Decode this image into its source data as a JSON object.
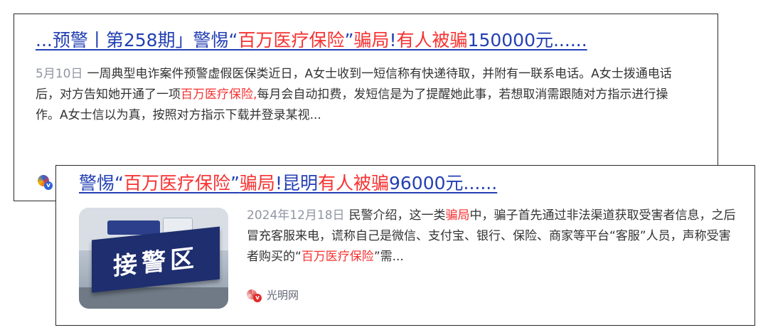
{
  "result1": {
    "title": {
      "seg1": "...预警丨第258期」警惕“",
      "seg2": "百万医疗保险",
      "seg3": "”",
      "seg4": "骗局",
      "seg5": "!",
      "seg6": "有人被骗",
      "seg7": "150000元......"
    },
    "date": "5月10日",
    "snippet": {
      "part1": "一周典型电诈案件预警虚假医保类近日，A女士收到一短信称有快递待取，并附有一联系电话。A女士拨通电话后，对方告知她开通了一项",
      "highlight": "百万医疗保险,",
      "part2": "每月会自动扣费，发短信是为了提醒她此事，若想取消需跟随对方指示进行操作。A女士信以为真，按照对方指示下载并登录某视..."
    },
    "icon": "media-source-icon"
  },
  "result2": {
    "title": {
      "seg1": "警惕“",
      "seg2": "百万医疗保险",
      "seg3": "”",
      "seg4": "骗局",
      "seg5": "!昆明",
      "seg6": "有人被骗",
      "seg7": "96000元......"
    },
    "thumbnail": {
      "sign_text": "接警区"
    },
    "date": "2024年12月18日",
    "snippet": {
      "part1": "民警介绍，这一类",
      "highlight1": "骗局",
      "part2": "中，骗子首先通过非法渠道获取受害者信息，之后冒充客服来电，谎称自己是微信、支付宝、银行、保险、商家等平台“客服”人员，声称受害者购买的“",
      "highlight2": "百万医疗保险",
      "part3": "”需..."
    },
    "source": {
      "name": "光明网",
      "badge": "v"
    }
  },
  "colors": {
    "link": "#2440b3",
    "highlight": "#f73131",
    "date": "#9195a3",
    "text": "#333333"
  }
}
